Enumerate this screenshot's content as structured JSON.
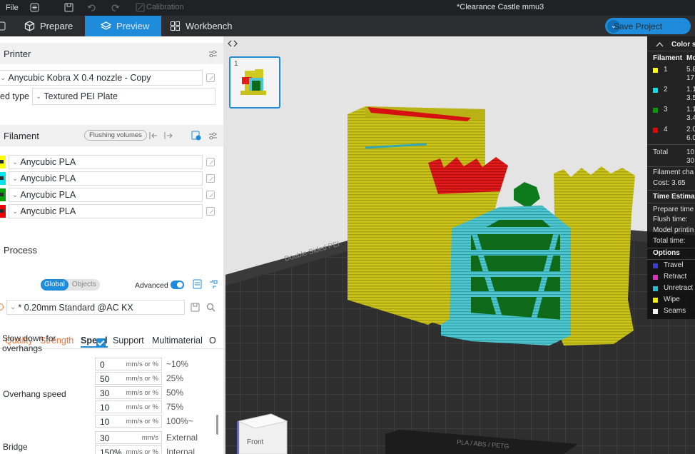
{
  "titlebar": {
    "file": "File",
    "calibration": "Calibration",
    "project_title": "*Clearance Castle mmu3"
  },
  "toolbar": {
    "tabs": [
      {
        "label": "Prepare",
        "icon": "cube-icon"
      },
      {
        "label": "Preview",
        "icon": "layers-icon",
        "active": true
      },
      {
        "label": "Workbench",
        "icon": "grid-icon"
      }
    ],
    "save_label": "Save Project"
  },
  "printer": {
    "title": "Printer",
    "preset": "Anycubic Kobra X 0.4 nozzle - Copy",
    "bed_label": "ed type",
    "bed_value": "Textured PEI Plate"
  },
  "filament": {
    "title": "Filament",
    "flushing": "Flushing volumes",
    "items": [
      {
        "name": "Anycubic PLA",
        "color": "#ffff00"
      },
      {
        "name": "Anycubic PLA",
        "color": "#00e5ee"
      },
      {
        "name": "Anycubic PLA",
        "color": "#00a000"
      },
      {
        "name": "Anycubic PLA",
        "color": "#ee0000"
      }
    ]
  },
  "process": {
    "title": "Process",
    "seg_global": "Global",
    "seg_objects": "Objects",
    "advanced": "Advanced",
    "preset": "* 0.20mm Standard @AC KX",
    "tabs": [
      "Quality",
      "Strength",
      "Speed",
      "Support",
      "Multimaterial",
      "O"
    ],
    "active_tab": "Speed",
    "slow_down_label": "Slow down for overhangs",
    "slow_down_checked": true,
    "overhang_label": "Overhang speed",
    "overhang_rows": [
      {
        "value": "0",
        "unit": "mm/s or %",
        "pct": "~10%"
      },
      {
        "value": "50",
        "unit": "mm/s or %",
        "pct": "25%"
      },
      {
        "value": "30",
        "unit": "mm/s or %",
        "pct": "50%"
      },
      {
        "value": "10",
        "unit": "mm/s or %",
        "pct": "75%"
      },
      {
        "value": "10",
        "unit": "mm/s or %",
        "pct": "100%~"
      }
    ],
    "bridge_label": "Bridge",
    "bridge_rows": [
      {
        "value": "30",
        "unit": "mm/s",
        "pct": "External"
      },
      {
        "value": "150%",
        "unit": "mm/s or %",
        "pct": "Internal"
      }
    ]
  },
  "plate": {
    "number": "1"
  },
  "legend": {
    "header": "Color s",
    "col_filament": "Filament",
    "col_m": "Mo",
    "rows": [
      {
        "num": "1",
        "color": "#ffff00",
        "v1": "5.8",
        "v2": "17"
      },
      {
        "num": "2",
        "color": "#00e5ee",
        "v1": "1.1",
        "v2": "3.5"
      },
      {
        "num": "3",
        "color": "#00a000",
        "v1": "1.1",
        "v2": "3.4"
      },
      {
        "num": "4",
        "color": "#ee0000",
        "v1": "2.0",
        "v2": "6.0"
      }
    ],
    "total_label": "Total",
    "total_v1": "10",
    "total_v2": "30",
    "filament_change": "Filament cha",
    "cost": "Cost:  3.65",
    "time_header": "Time Estima",
    "time_rows": [
      "Prepare time",
      "Flush time:",
      "Model printin",
      "Total time:"
    ],
    "options_header": "Options",
    "options": [
      {
        "label": "Travel",
        "color": "#3b3bd8"
      },
      {
        "label": "Retract",
        "color": "#e030c0"
      },
      {
        "label": "Unretract",
        "color": "#20c0d0"
      },
      {
        "label": "Wipe",
        "color": "#f2f000"
      },
      {
        "label": "Seams",
        "color": "#f4f4f4"
      }
    ]
  },
  "bed": {
    "front_label": "Front",
    "plate_side_text": "Double-Sided PEI",
    "plate_front_text": "PLA / ABS / PETG"
  }
}
